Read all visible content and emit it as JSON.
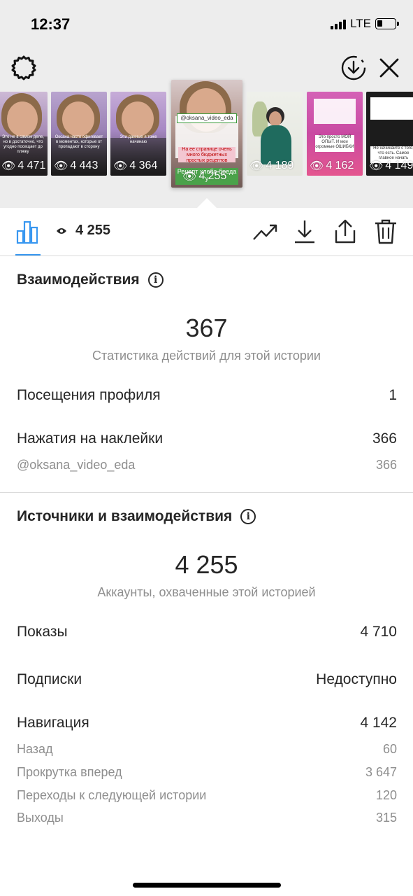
{
  "status_bar": {
    "time": "12:37",
    "network": "LTE"
  },
  "colors": {
    "accent": "#3897f0",
    "secondary_text": "#8e8e8e",
    "primary_text": "#262626",
    "top_bg": "#ededed"
  },
  "icons": {
    "settings": "gear-icon",
    "save": "download-circle-icon",
    "close": "close-icon"
  },
  "stories": [
    {
      "views": "4 471",
      "caption": "Это не в самом деле, но в достаточно, что угодно посещает до пляжу"
    },
    {
      "views": "4 443",
      "caption": "Оксана часто офигевает в моментах, которые от пропадают в сторону"
    },
    {
      "views": "4 364",
      "caption": "Эти данные я тоже начинаю"
    },
    {
      "views": "4 255",
      "caption_top": "@oksana_video_eda",
      "caption_mid": "На ее странице очень много бюджетных простых рецептов",
      "caption_bottom": "Рецепт хлеба бреда у"
    },
    {
      "views": "4 189",
      "caption": ""
    },
    {
      "views": "4 162",
      "caption": "Это просто МОЙ ОПЫТ. И мои огромные ОШИБКИ"
    },
    {
      "views": "4 149",
      "caption": "Не начинайте с того, что есть. Самое главное начать"
    }
  ],
  "toolbar": {
    "views": "4 255"
  },
  "interactions": {
    "title": "Взаимодействия",
    "total": "367",
    "caption": "Статистика действий для этой истории",
    "rows": [
      {
        "label": "Посещения профиля",
        "value": "1"
      },
      {
        "label": "Нажатия на наклейки",
        "value": "366"
      }
    ],
    "sub_rows": [
      {
        "label": "@oksana_video_eda",
        "value": "366"
      }
    ]
  },
  "discovery": {
    "title": "Источники и взаимодействия",
    "total": "4 255",
    "caption": "Аккаунты, охваченные этой историей",
    "rows": [
      {
        "label": "Показы",
        "value": "4 710"
      },
      {
        "label": "Подписки",
        "value": "Недоступно"
      },
      {
        "label": "Навигация",
        "value": "4 142"
      }
    ],
    "navigation": [
      {
        "label": "Назад",
        "value": "60"
      },
      {
        "label": "Прокрутка вперед",
        "value": "3 647"
      },
      {
        "label": "Переходы к следующей истории",
        "value": "120"
      },
      {
        "label": "Выходы",
        "value": "315"
      }
    ]
  }
}
